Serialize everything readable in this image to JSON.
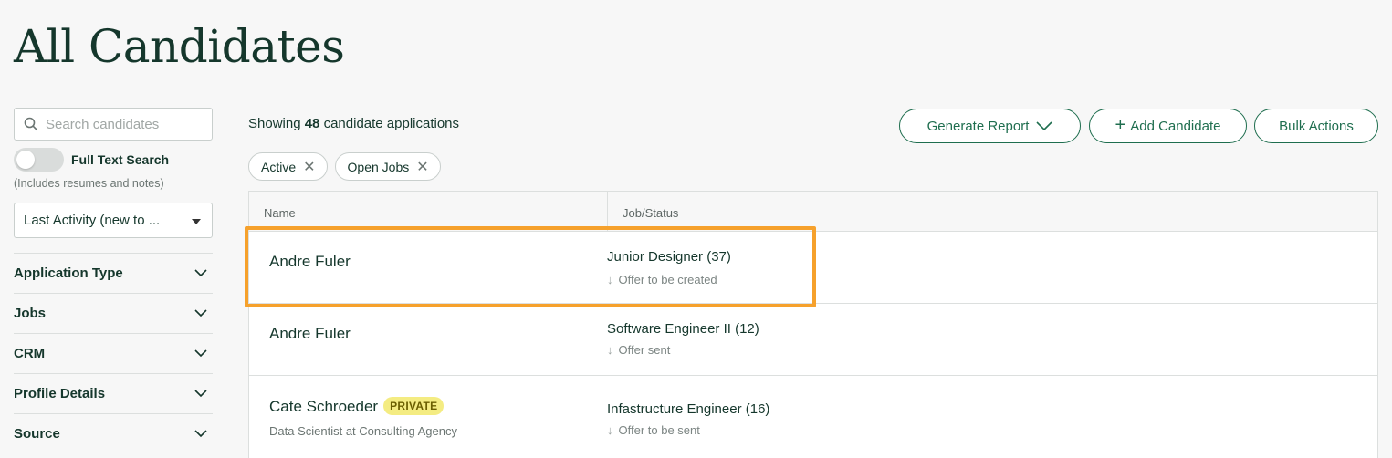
{
  "page": {
    "title": "All Candidates"
  },
  "sidebar": {
    "search_placeholder": "Search candidates",
    "full_text_search_label": "Full Text Search",
    "full_text_search_hint": "(Includes resumes and notes)",
    "sort_value": "Last Activity (new to ...",
    "filters": [
      {
        "label": "Application Type"
      },
      {
        "label": "Jobs"
      },
      {
        "label": "CRM"
      },
      {
        "label": "Profile Details"
      },
      {
        "label": "Source"
      }
    ]
  },
  "summary": {
    "prefix": "Showing",
    "count": "48",
    "suffix": "candidate applications"
  },
  "active_filters": [
    {
      "label": "Active"
    },
    {
      "label": "Open Jobs"
    }
  ],
  "actions": {
    "generate_report": "Generate Report",
    "add_candidate": "Add Candidate",
    "bulk_actions": "Bulk Actions"
  },
  "table": {
    "headers": {
      "name": "Name",
      "job_status": "Job/Status"
    },
    "rows": [
      {
        "name": "Andre Fuler",
        "job": "Junior Designer (37)",
        "status": "Offer to be created"
      },
      {
        "name": "Andre Fuler",
        "job": "Software Engineer II (12)",
        "status": "Offer sent"
      },
      {
        "name": "Cate Schroeder",
        "badge": "PRIVATE",
        "subtitle": "Data Scientist at Consulting Agency",
        "job": "Infastructure Engineer (16)",
        "status": "Offer to be sent"
      }
    ]
  },
  "colors": {
    "accent": "#1f6e4f",
    "highlight": "#f6a12c",
    "badge": "#f4ec82",
    "text": "#15372c"
  }
}
